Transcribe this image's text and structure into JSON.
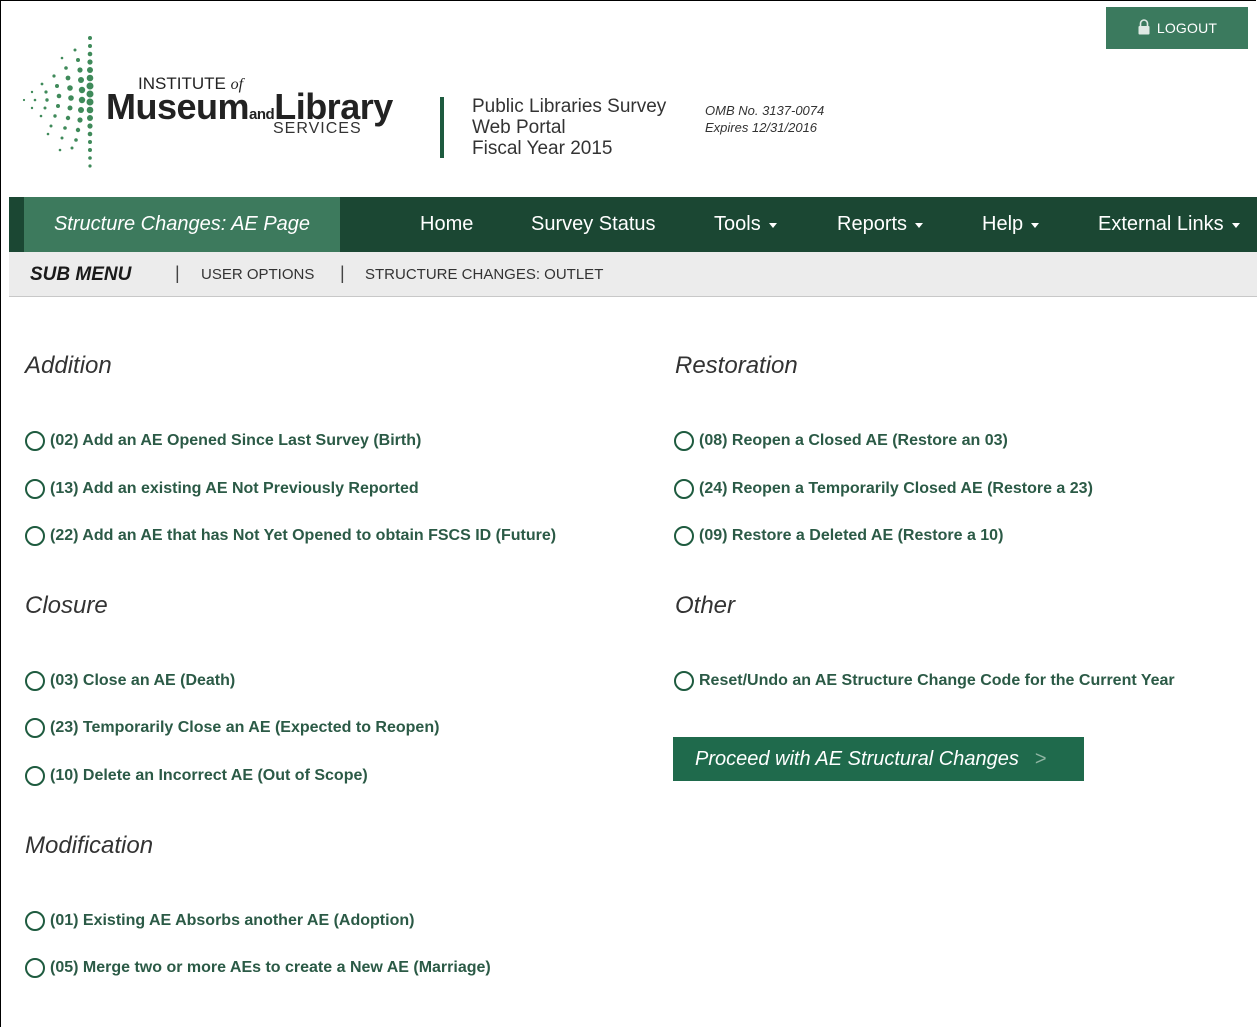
{
  "header": {
    "logout_label": "LOGOUT",
    "logo": {
      "institute": "INSTITUTE",
      "of": "of",
      "museum": "Museum",
      "and": "and",
      "library": "Library",
      "services": "SERVICES"
    },
    "portal_lines": [
      "Public Libraries Survey",
      "Web Portal",
      "Fiscal Year 2015"
    ],
    "omb_number": "OMB No. 3137-0074",
    "omb_expires": "Expires 12/31/2016"
  },
  "nav": {
    "current_page": "Structure Changes: AE Page",
    "items": [
      {
        "label": "Home",
        "dropdown": false
      },
      {
        "label": "Survey Status",
        "dropdown": false
      },
      {
        "label": "Tools",
        "dropdown": true
      },
      {
        "label": "Reports",
        "dropdown": true
      },
      {
        "label": "Help",
        "dropdown": true
      },
      {
        "label": "External Links",
        "dropdown": true
      }
    ]
  },
  "submenu": {
    "title": "SUB MENU",
    "links": [
      "USER OPTIONS",
      "STRUCTURE CHANGES: OUTLET"
    ]
  },
  "sections": {
    "addition": {
      "title": "Addition",
      "options": [
        "(02) Add an AE Opened Since Last Survey (Birth)",
        "(13) Add an existing AE Not Previously Reported",
        "(22) Add an AE that has Not Yet Opened to obtain FSCS ID (Future)"
      ]
    },
    "closure": {
      "title": "Closure",
      "options": [
        "(03) Close an AE (Death)",
        "(23) Temporarily Close an AE (Expected to Reopen)",
        "(10) Delete an Incorrect AE (Out of Scope)"
      ]
    },
    "modification": {
      "title": "Modification",
      "options": [
        "(01) Existing AE Absorbs another AE (Adoption)",
        "(05) Merge two or more AEs to create a New AE (Marriage)"
      ]
    },
    "restoration": {
      "title": "Restoration",
      "options": [
        "(08) Reopen a Closed AE (Restore an 03)",
        "(24) Reopen a Temporarily Closed AE (Restore a 23)",
        "(09) Restore a Deleted AE (Restore a 10)"
      ]
    },
    "other": {
      "title": "Other",
      "options": [
        "Reset/Undo an AE Structure Change Code for the Current Year"
      ]
    }
  },
  "proceed_button": {
    "label": "Proceed with AE Structural Changes",
    "chevron": ">"
  },
  "colors": {
    "nav_dark": "#1b4733",
    "nav_active": "#3d7a5d",
    "accent_green": "#1f6a4c",
    "option_text": "#2b5a46"
  }
}
